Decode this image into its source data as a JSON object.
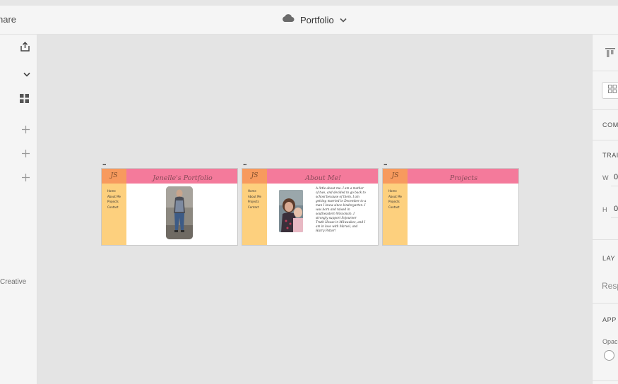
{
  "toolbar": {
    "share_fragment": "hare",
    "document_title": "Portfolio",
    "title_icon": "cloud-icon",
    "dropdown_icon": "chevron-down-icon"
  },
  "left_rail": {
    "icons": [
      "export-icon",
      "chevron-down-icon",
      "grid-icon",
      "plus-icon",
      "plus-icon",
      "plus-icon"
    ],
    "creative_label": "Creative"
  },
  "right_panel": {
    "component_label": "COM",
    "transform_label": "TRAI",
    "width_label": "W",
    "width_value": "0",
    "height_label": "H",
    "height_value": "0",
    "layout_label": "LAY",
    "responsive_label": "Resp",
    "appearance_label": "APP",
    "opacity_label": "Opac"
  },
  "artboards": [
    {
      "more_label": "...",
      "logo": "JS",
      "title": "Jenelle's Portfolio",
      "nav": [
        "Home",
        "About Me",
        "Projects",
        "Contact"
      ]
    },
    {
      "more_label": "...",
      "logo": "JS",
      "title": "About Me!",
      "nav": [
        "Home",
        "About Me",
        "Projects",
        "Contact"
      ],
      "bio_lines": [
        "A little about me. I am a mother",
        "of two, and decided to go back to",
        "school because of them. I am",
        "getting married in December to a",
        "man I knew since kindergarten. I",
        "was born and raised in",
        "southeastern Wisconsin. I",
        "strongly support Sojourner",
        "Truth House in Milwaukee, and I",
        "am in love with Marvel, and",
        "Harry Potter!"
      ]
    },
    {
      "more_label": "...",
      "logo": "JS",
      "title": "Projects",
      "nav": [
        "Home",
        "About Me",
        "Projects",
        "Contact"
      ]
    }
  ],
  "colors": {
    "header_pink": "#f47a9b",
    "logo_orange": "#f79a5e",
    "sidebar_yellow": "#fdd07e",
    "canvas": "#e4e4e4"
  }
}
